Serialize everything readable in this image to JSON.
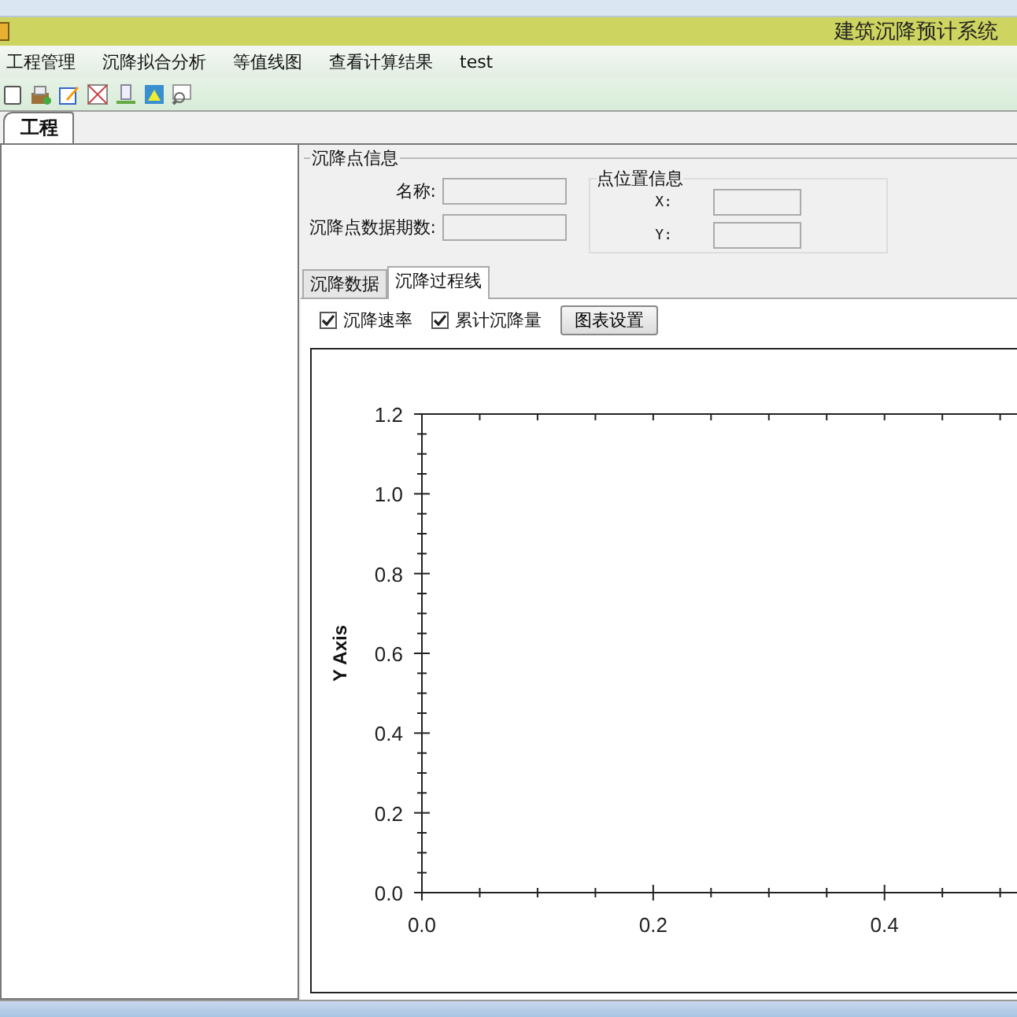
{
  "window": {
    "title": "建筑沉降预计系统"
  },
  "menu": [
    {
      "label": "工程管理"
    },
    {
      "label": "沉降拟合分析"
    },
    {
      "label": "等值线图"
    },
    {
      "label": "查看计算结果"
    },
    {
      "label": "test"
    }
  ],
  "toolbar": [
    {
      "kind": "new"
    },
    {
      "kind": "open"
    },
    {
      "kind": "edit"
    },
    {
      "kind": "grid"
    },
    {
      "kind": "export"
    },
    {
      "kind": "chart"
    },
    {
      "kind": "search"
    }
  ],
  "left_tabs": [
    {
      "label": "工程",
      "selected": true
    }
  ],
  "point_info": {
    "title": "沉降点信息",
    "fields": [
      {
        "label": "名称:"
      },
      {
        "label": "沉降点数据期数:"
      }
    ],
    "position": {
      "title": "点位置信息",
      "fields": [
        {
          "label": "X:"
        },
        {
          "label": "Y:"
        }
      ]
    }
  },
  "tabs": [
    {
      "label": "沉降数据",
      "selected": false
    },
    {
      "label": "沉降过程线",
      "selected": true
    }
  ],
  "options": [
    {
      "label": "沉降速率",
      "checked": true
    },
    {
      "label": "累计沉降量",
      "checked": true
    }
  ],
  "chart_button": "图表设置",
  "chart": {
    "chart_data": {
      "type": "line",
      "ylabel": "Y Axis",
      "xlim": [
        0,
        0.52
      ],
      "ylim": [
        0,
        1.2
      ],
      "xticks": [
        {
          "value": 0,
          "label": "0.0"
        },
        {
          "value": 0.2,
          "label": "0.2"
        },
        {
          "value": 0.4,
          "label": "0.4"
        }
      ],
      "yticks": [
        {
          "value": 0,
          "label": "0.0"
        },
        {
          "value": 0.2,
          "label": "0.2"
        },
        {
          "value": 0.4,
          "label": "0.4"
        },
        {
          "value": 0.6,
          "label": "0.6"
        },
        {
          "value": 0.8,
          "label": "0.8"
        },
        {
          "value": 1.0,
          "label": "1.0"
        },
        {
          "value": 1.2,
          "label": "1.2"
        }
      ]
    }
  }
}
